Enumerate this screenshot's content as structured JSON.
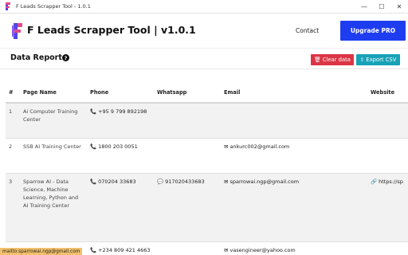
{
  "window": {
    "title": "F Leads Scrapper Tool - 1.0.1",
    "minimize": "—",
    "maximize": "☐",
    "close": "✕"
  },
  "nav": {
    "brand": "F Leads Scrapper Tool | v1.0.1",
    "contact": "Contact",
    "upgrade": "Upgrade PRO"
  },
  "report": {
    "title": "Data Report",
    "help": "?",
    "clear_label": "Clear data",
    "export_label": "Export CSV"
  },
  "table": {
    "columns": [
      "#",
      "Page Name",
      "Phone",
      "Whatsapp",
      "Email",
      "Website"
    ],
    "rows": [
      {
        "num": "1",
        "page_name": "Ai Computer Training Center",
        "phone": "+95 9 799 892198",
        "whatsapp": "",
        "email": "",
        "website": ""
      },
      {
        "num": "2",
        "page_name": "SSB AI Training Center",
        "phone": "1800 203 0051",
        "whatsapp": "",
        "email": "ankurc002@gmail.com",
        "website": ""
      },
      {
        "num": "3",
        "page_name": "Sparrow AI - Data Science, Machine Learning, Python and AI Training Center",
        "phone": "070204 33683",
        "whatsapp": "917020433683",
        "email": "sparrowai.ngp@gmail.com",
        "website": "https://sp"
      },
      {
        "num": "4",
        "page_name": "Real Ai training",
        "phone": "+234 809 421 4663",
        "whatsapp": "",
        "email": "vasengineer@yahoo.com",
        "website": ""
      }
    ]
  },
  "status": {
    "text": "mailto:sparrowai.ngp@gmail.com"
  },
  "colors": {
    "upgrade": "#1f3df0",
    "clear": "#dc3545",
    "export": "#17a2b8",
    "status": "#f2c06a"
  },
  "icons": {
    "phone": "phone-icon",
    "whatsapp": "whatsapp-icon",
    "email": "envelope-icon",
    "website": "link-icon",
    "clear": "trash-icon",
    "export": "export-icon"
  }
}
